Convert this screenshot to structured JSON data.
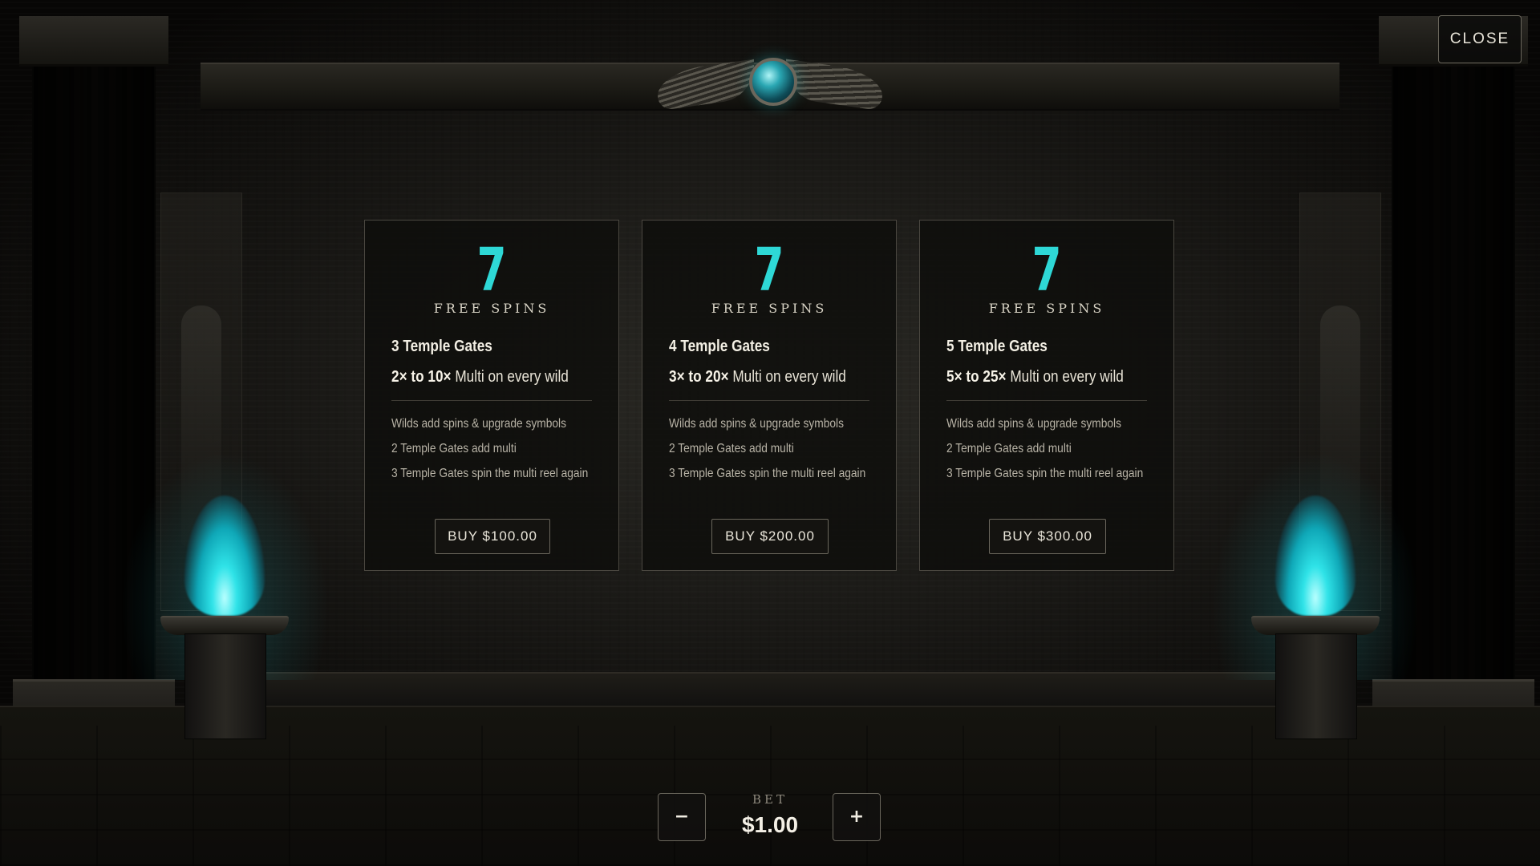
{
  "close_button": {
    "label": "CLOSE"
  },
  "colors": {
    "accent": "#2ed8d6",
    "flame": "#2fe3e8",
    "card_border": "#4a4740",
    "background": "#1b1a17"
  },
  "cards": [
    {
      "spins": "7",
      "spins_label": "FREE SPINS",
      "title": "3 Temple Gates",
      "multi_range": "2× to 10×",
      "multi_suffix": " Multi on every wild",
      "features": [
        "Wilds add spins & upgrade symbols",
        "2 Temple Gates add multi",
        "3 Temple Gates spin the multi reel again"
      ],
      "buy_label": "BUY $100.00"
    },
    {
      "spins": "7",
      "spins_label": "FREE SPINS",
      "title": "4 Temple Gates",
      "multi_range": "3× to 20×",
      "multi_suffix": " Multi on every wild",
      "features": [
        "Wilds add spins & upgrade symbols",
        "2 Temple Gates add multi",
        "3 Temple Gates spin the multi reel again"
      ],
      "buy_label": "BUY $200.00"
    },
    {
      "spins": "7",
      "spins_label": "FREE SPINS",
      "title": "5 Temple Gates",
      "multi_range": "5× to 25×",
      "multi_suffix": " Multi on every wild",
      "features": [
        "Wilds add spins & upgrade symbols",
        "2 Temple Gates add multi",
        "3 Temple Gates spin the multi reel again"
      ],
      "buy_label": "BUY $300.00"
    }
  ],
  "bet": {
    "label": "BET",
    "value": "$1.00",
    "decrease_symbol": "−",
    "increase_symbol": "+"
  },
  "icons": {
    "emblem": "winged-scarab-icon",
    "flame": "blue-flame-icon"
  }
}
